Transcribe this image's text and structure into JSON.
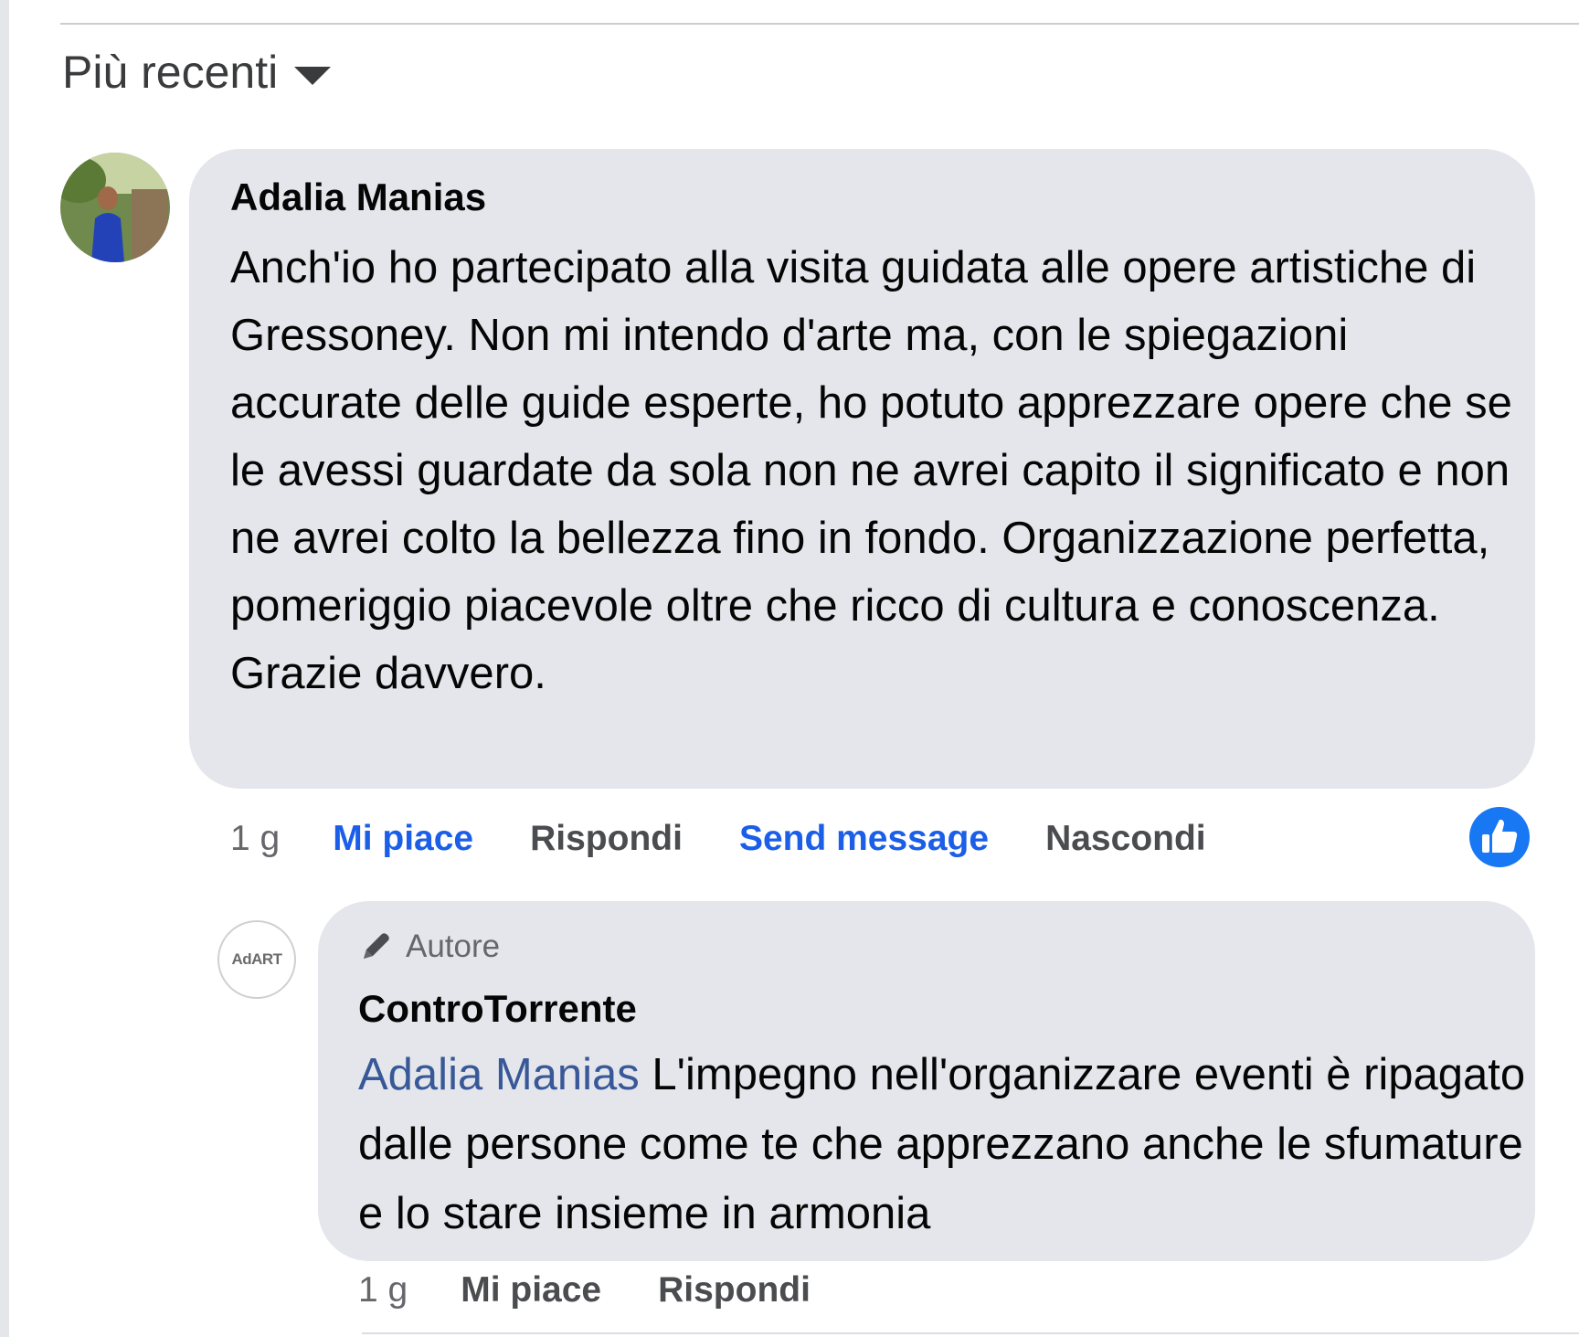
{
  "sort": {
    "label": "Più recenti"
  },
  "comment": {
    "author": "Adalia Manias",
    "text": "Anch'io ho partecipato alla visita guidata alle opere artistiche di Gressoney. Non mi intendo d'arte ma, con le spiegazioni accurate delle guide esperte, ho potuto apprezzare opere che se le avessi guardate da sola non ne avrei capito il significato e non ne avrei colto la bellezza fino in fondo. Organizzazione perfetta, pomeriggio piacevole oltre che ricco di cultura e conoscenza. Grazie davvero.",
    "time": "1 g",
    "actions": {
      "like": "Mi piace",
      "reply": "Rispondi",
      "send_message": "Send message",
      "hide": "Nascondi"
    },
    "reaction_icon": "like-icon"
  },
  "reply": {
    "avatar_text": "AdART",
    "badge": "Autore",
    "badge_icon": "pencil-icon",
    "author": "ControTorrente",
    "mention": "Adalia Manias",
    "text": " L'impegno nell'organizzare eventi è ripagato dalle persone come te che apprezzano anche le sfumature e lo stare insieme in armonia",
    "time": "1 g",
    "actions": {
      "like": "Mi piace",
      "reply": "Rispondi"
    }
  },
  "colors": {
    "bubble": "#e4e6eb",
    "link_blue": "#1b5ee8",
    "mention_blue": "#385898",
    "secondary_text": "#65676b"
  }
}
